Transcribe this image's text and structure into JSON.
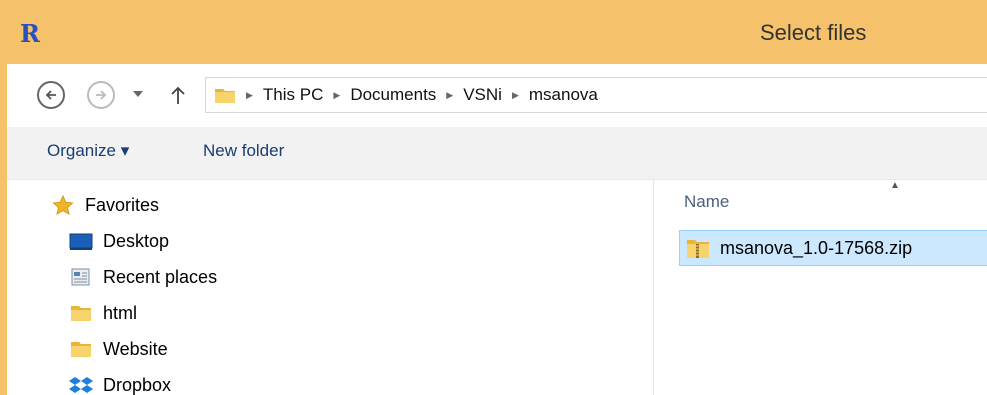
{
  "window": {
    "title": "Select files",
    "app_icon": "R"
  },
  "nav": {
    "back": "back-arrow-icon",
    "forward": "forward-arrow-icon",
    "recent": "chevron-down-icon",
    "up": "up-arrow-icon"
  },
  "address": {
    "crumbs": [
      "This PC",
      "Documents",
      "VSNi",
      "msanova"
    ]
  },
  "toolbar": {
    "organize": "Organize ▾",
    "new_folder": "New folder"
  },
  "sidebar": {
    "items": [
      {
        "label": "Favorites",
        "icon": "star-icon"
      },
      {
        "label": "Desktop",
        "icon": "desktop-icon"
      },
      {
        "label": "Recent places",
        "icon": "recent-places-icon"
      },
      {
        "label": "html",
        "icon": "folder-icon"
      },
      {
        "label": "Website",
        "icon": "folder-icon"
      },
      {
        "label": "Dropbox",
        "icon": "dropbox-icon"
      }
    ]
  },
  "files": {
    "column_name": "Name",
    "items": [
      {
        "name": "msanova_1.0-17568.zip",
        "icon": "zip-folder-icon",
        "selected": true
      }
    ]
  },
  "colors": {
    "title_bar": "#f5c16a",
    "selection": "#cce8ff",
    "toolbar_text": "#1a3e72"
  }
}
